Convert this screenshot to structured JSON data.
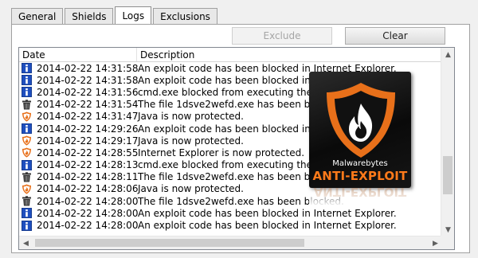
{
  "tabs": [
    {
      "label": "General",
      "active": false
    },
    {
      "label": "Shields",
      "active": false
    },
    {
      "label": "Logs",
      "active": true
    },
    {
      "label": "Exclusions",
      "active": false
    }
  ],
  "buttons": {
    "exclude_label": "Exclude",
    "exclude_enabled": false,
    "clear_label": "Clear"
  },
  "columns": {
    "date": "Date",
    "description": "Description"
  },
  "rows": [
    {
      "icon": "info-icon",
      "date": "2014-02-22 14:31:58",
      "description": "An exploit code has been blocked in Internet Explorer."
    },
    {
      "icon": "info-icon",
      "date": "2014-02-22 14:31:58",
      "description": "An exploit code has been blocked in Internet Explorer."
    },
    {
      "icon": "info-icon",
      "date": "2014-02-22 14:31:56",
      "description": "cmd.exe blocked from executing the malicious file"
    },
    {
      "icon": "trash-icon",
      "date": "2014-02-22 14:31:54",
      "description": "The file 1dsve2wefd.exe has been blocked."
    },
    {
      "icon": "shield-icon",
      "date": "2014-02-22 14:31:47",
      "description": "Java is now protected."
    },
    {
      "icon": "info-icon",
      "date": "2014-02-22 14:29:26",
      "description": "An exploit code has been blocked in Internet Explorer."
    },
    {
      "icon": "shield-icon",
      "date": "2014-02-22 14:29:17",
      "description": "Java is now protected."
    },
    {
      "icon": "shield-icon",
      "date": "2014-02-22 14:28:55",
      "description": "Internet Explorer is now protected."
    },
    {
      "icon": "info-icon",
      "date": "2014-02-22 14:28:13",
      "description": "cmd.exe blocked from executing the malicious file"
    },
    {
      "icon": "trash-icon",
      "date": "2014-02-22 14:28:11",
      "description": "The file 1dsve2wefd.exe has been blocked."
    },
    {
      "icon": "shield-icon",
      "date": "2014-02-22 14:28:06",
      "description": "Java is now protected."
    },
    {
      "icon": "trash-icon",
      "date": "2014-02-22 14:28:00",
      "description": "The file 1dsve2wefd.exe has been blocked."
    },
    {
      "icon": "info-icon",
      "date": "2014-02-22 14:28:00",
      "description": "An exploit code has been blocked in Internet Explorer."
    },
    {
      "icon": "info-icon",
      "date": "2014-02-22 14:28:00",
      "description": "An exploit code has been blocked in Internet Explorer."
    }
  ],
  "product": {
    "brand": "Malwarebytes",
    "name": "ANTI-EXPLOIT"
  },
  "colors": {
    "info": "#1f4fbf",
    "shield_orange": "#e8701a",
    "trash": "#333333",
    "product_orange": "#ff7a1a"
  }
}
